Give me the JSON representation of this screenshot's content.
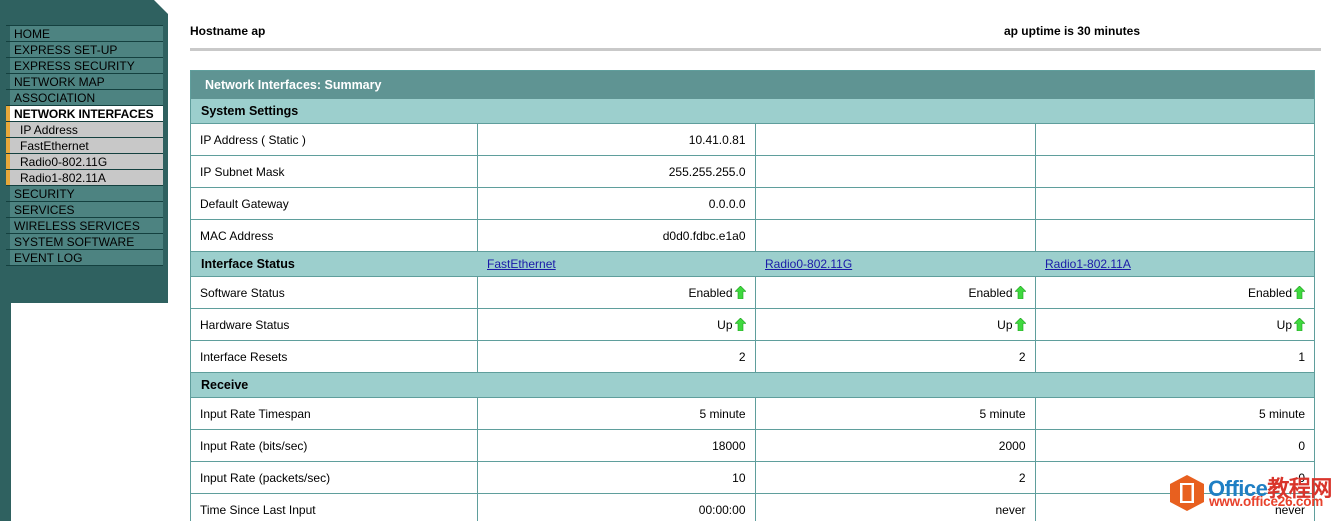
{
  "sidebar": {
    "items": [
      {
        "label": "HOME",
        "type": "top",
        "active": false
      },
      {
        "label": "EXPRESS SET-UP",
        "type": "top",
        "active": false
      },
      {
        "label": "EXPRESS SECURITY",
        "type": "top",
        "active": false
      },
      {
        "label": "NETWORK MAP",
        "type": "top",
        "active": false
      },
      {
        "label": "ASSOCIATION",
        "type": "top",
        "active": false
      },
      {
        "label": "NETWORK INTERFACES",
        "type": "top",
        "active": true
      },
      {
        "label": "IP Address",
        "type": "sub",
        "active": false
      },
      {
        "label": "FastEthernet",
        "type": "sub",
        "active": false
      },
      {
        "label": "Radio0-802.11G",
        "type": "sub",
        "active": false
      },
      {
        "label": "Radio1-802.11A",
        "type": "sub",
        "active": false
      },
      {
        "label": "SECURITY",
        "type": "top",
        "active": false
      },
      {
        "label": "SERVICES",
        "type": "top",
        "active": false
      },
      {
        "label": "WIRELESS SERVICES",
        "type": "top",
        "active": false
      },
      {
        "label": "SYSTEM SOFTWARE",
        "type": "top",
        "active": false
      },
      {
        "label": "EVENT LOG",
        "type": "top",
        "active": false
      }
    ]
  },
  "header": {
    "hostname": "Hostname ap",
    "uptime": "ap uptime is 30 minutes"
  },
  "panel": {
    "title": "Network Interfaces: Summary"
  },
  "sections": {
    "system_settings": {
      "title": "System Settings",
      "rows": [
        {
          "label": "IP Address ( Static )",
          "v1": "10.41.0.81",
          "v2": "",
          "v3": ""
        },
        {
          "label": "IP Subnet Mask",
          "v1": "255.255.255.0",
          "v2": "",
          "v3": ""
        },
        {
          "label": "Default Gateway",
          "v1": "0.0.0.0",
          "v2": "",
          "v3": ""
        },
        {
          "label": "MAC Address",
          "v1": "d0d0.fdbc.e1a0",
          "v2": "",
          "v3": ""
        }
      ]
    },
    "interface_status": {
      "title": "Interface Status",
      "col1": "FastEthernet",
      "col2": "Radio0-802.11G",
      "col3": "Radio1-802.11A",
      "rows": [
        {
          "label": "Software Status",
          "v1": "Enabled",
          "v2": "Enabled",
          "v3": "Enabled",
          "arrow": true
        },
        {
          "label": "Hardware Status",
          "v1": "Up",
          "v2": "Up",
          "v3": "Up",
          "arrow": true
        },
        {
          "label": "Interface Resets",
          "v1": "2",
          "v2": "2",
          "v3": "1",
          "arrow": false
        }
      ]
    },
    "receive": {
      "title": "Receive",
      "rows": [
        {
          "label": "Input Rate Timespan",
          "v1": "5 minute",
          "v2": "5 minute",
          "v3": "5 minute"
        },
        {
          "label": "Input Rate (bits/sec)",
          "v1": "18000",
          "v2": "2000",
          "v3": "0"
        },
        {
          "label": "Input Rate (packets/sec)",
          "v1": "10",
          "v2": "2",
          "v3": "0"
        },
        {
          "label": "Time Since Last Input",
          "v1": "00:00:00",
          "v2": "never",
          "v3": "never"
        }
      ]
    }
  },
  "watermark": {
    "line1_en": "Office",
    "line1_cn": "教程网",
    "line2": "www.office26.com"
  },
  "colors": {
    "sidebar_dark": "#2f6160",
    "sidebar_item": "#4d8381",
    "sidebar_sub": "#c8c8c8",
    "accent_gold": "#e8a83a",
    "panel_title": "#5f9493",
    "section_bg": "#9ccfcd",
    "grid_line": "#5f9e9c",
    "link": "#1a1aa8",
    "arrow_green": "#3fd93f"
  }
}
